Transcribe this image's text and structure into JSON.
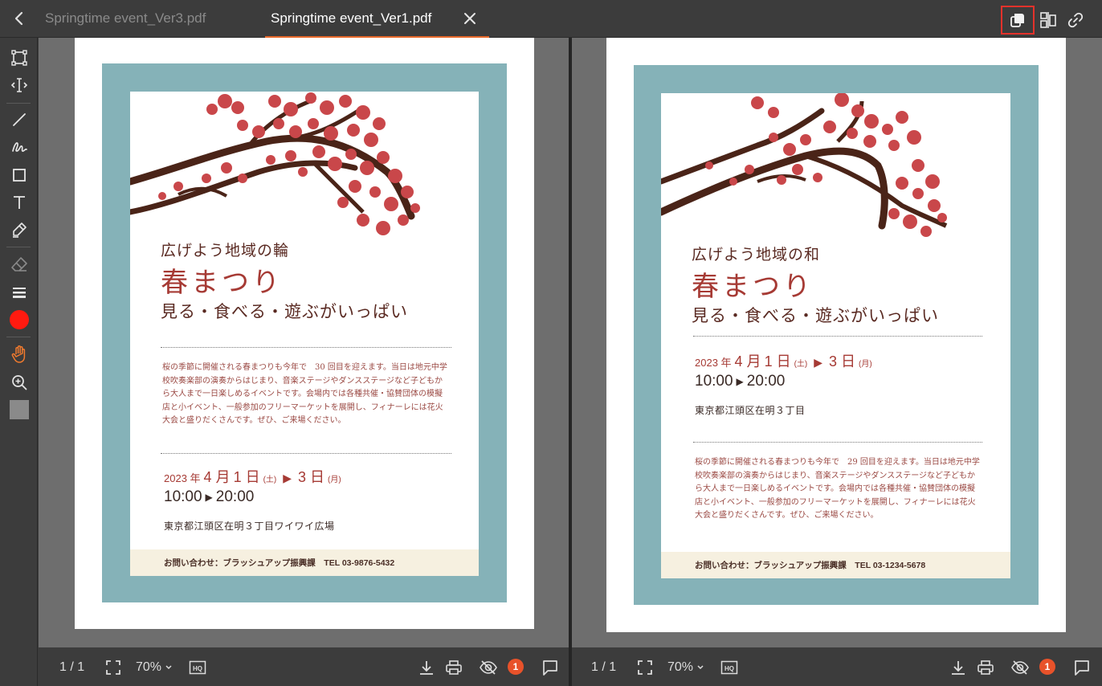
{
  "tabs": {
    "inactive_title": "Springtime event_Ver3.pdf",
    "active_title": "Springtime event_Ver1.pdf"
  },
  "toolbar_right": {
    "icons": [
      "copy-pages-icon",
      "compare-icon",
      "link-icon"
    ]
  },
  "left_tools": [
    "select-box-icon",
    "text-select-icon",
    "line-icon",
    "freehand-icon",
    "rectangle-icon",
    "text-icon",
    "highlighter-icon",
    "eraser-icon",
    "line-weight-icon",
    "color-swatch-icon",
    "hand-icon",
    "zoom-in-icon",
    "fill-swatch-icon"
  ],
  "colors": {
    "accent": "#e8692a",
    "highlight_border": "#e4322b",
    "pen_color": "#ff1a10",
    "frame": "#85b2b8",
    "title_red": "#a63a34"
  },
  "left_doc": {
    "subtitle": "広げよう地域の輪",
    "title": "春まつり",
    "tagline": "見る・食べる・遊ぶがいっぱい",
    "paragraph": "桜の季節に開催される春まつりも今年で　30 回目を迎えます。当日は地元中学校吹奏楽部の演奏からはじまり、音楽ステージやダンスステージなど子どもから大人まで一日楽しめるイベントです。会場内では各種共催・協賛団体の模擬店と小イベント、一般参加のフリーマーケットを展開し、フィナーレには花火大会と盛りだくさんです。ぜひ、ご来場ください。",
    "date_year": "2023 年",
    "date_month": "4 月",
    "date_day1": "1 日",
    "date_dow1": "(土)",
    "date_day2": "3 日",
    "date_dow2": "(月)",
    "time_start": "10:00",
    "time_end": "20:00",
    "address": "東京都江頭区在明３丁目ワイワイ広場",
    "contact": "お問い合わせ：ブラッシュアップ振興課　TEL 03-9876-5432"
  },
  "right_doc": {
    "subtitle": "広げよう地域の和",
    "title": "春まつり",
    "tagline": "見る・食べる・遊ぶがいっぱい",
    "paragraph": "桜の季節に開催される春まつりも今年で　29 回目を迎えます。当日は地元中学校吹奏楽部の演奏からはじまり、音楽ステージやダンスステージなど子どもから大人まで一日楽しめるイベントです。会場内では各種共催・協賛団体の模擬店と小イベント、一般参加のフリーマーケットを展開し、フィナーレには花火大会と盛りだくさんです。ぜひ、ご来場ください。",
    "date_year": "2023 年",
    "date_month": "4 月",
    "date_day1": "1 日",
    "date_dow1": "(土)",
    "date_day2": "3 日",
    "date_dow2": "(月)",
    "time_start": "10:00",
    "time_end": "20:00",
    "address": "東京都江頭区在明３丁目",
    "contact": "お問い合わせ：ブラッシュアップ振興課　TEL 03-1234-5678"
  },
  "footer_left": {
    "page": "1 / 1",
    "zoom": "70%",
    "badge": "1"
  },
  "footer_right": {
    "page": "1 / 1",
    "zoom": "70%",
    "badge": "1"
  }
}
